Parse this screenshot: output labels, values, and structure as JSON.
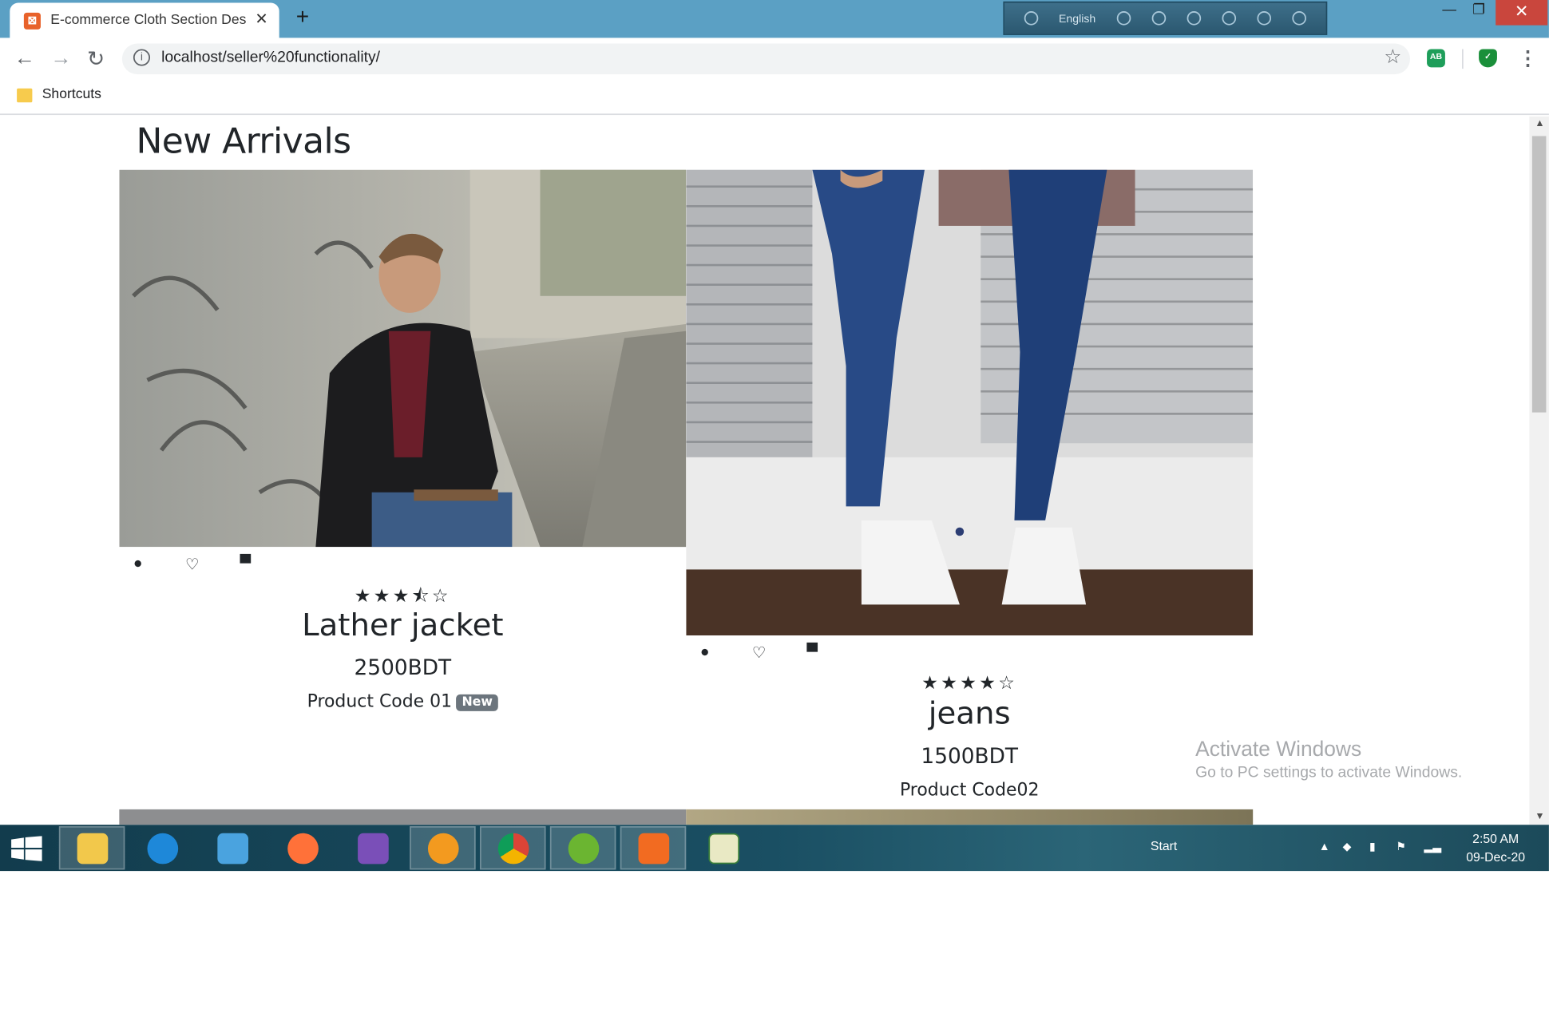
{
  "browser": {
    "tab_title": "E-commerce Cloth Section Desig",
    "tab_favicon_glyph": "⊠",
    "close_tab": "✕",
    "new_tab": "+",
    "url": "localhost/seller%20functionality/",
    "bookmark_folder": "Shortcuts",
    "language_bar": "English",
    "win_minimize": "—",
    "win_restore": "❐",
    "win_close": "✕",
    "ext1_label": "AB"
  },
  "page": {
    "heading": "New Arrivals",
    "products": [
      {
        "name": "Lather jacket",
        "price": "2500BDT",
        "code": "Product Code 01",
        "badge": "New",
        "stars": "★★★⯪☆",
        "rating": 3.5
      },
      {
        "name": "jeans",
        "price": "1500BDT",
        "code": "Product Code02",
        "stars": "★★★★☆",
        "rating": 4
      }
    ],
    "icons": {
      "view": "👁",
      "wishlist": "♡",
      "cart": "🛒"
    }
  },
  "watermark": {
    "line1": "Activate Windows",
    "line2": "Go to PC settings to activate Windows."
  },
  "taskbar": {
    "start_label": "Start",
    "time": "2:50 AM",
    "date": "09-Dec-20"
  },
  "colors": {
    "titlebar": "#5ba0c4",
    "close_red": "#c9463d",
    "badge_gray": "#6c757d",
    "text_dark": "#212529"
  }
}
